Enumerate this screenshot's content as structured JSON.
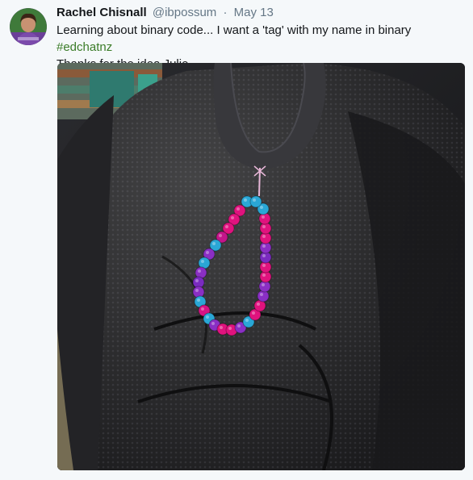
{
  "tweet": {
    "author_name": "Rachel Chisnall",
    "handle": "@ibpossum",
    "separator": "·",
    "date": "May 13",
    "text_line1": "Learning about binary code... I want a 'tag' with my name in binary ",
    "hashtag": "#edchatnz",
    "text_line2": "Thanks for the idea Julie"
  },
  "icons": {
    "avatar": "profile-photo",
    "media": "photo-beaded-keychain-on-backpack"
  },
  "colors": {
    "name": "#14171a",
    "meta": "#657786",
    "hashtag": "#3b7c28",
    "background": "#f5f8fa",
    "bead_pink": "#e0137e",
    "bead_blue": "#2aa7d6",
    "bead_purple": "#8a2fc4"
  }
}
